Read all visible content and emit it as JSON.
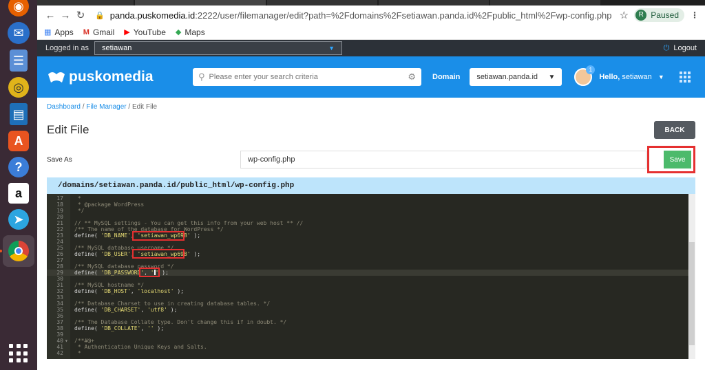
{
  "browser": {
    "url_host": "panda.puskomedia.id",
    "url_rest": ":2222/user/filemanager/edit?path=%2Fdomains%2Fsetiawan.panda.id%2Fpublic_html%2Fwp-config.php",
    "profile_initial": "R",
    "profile_status": "Paused",
    "bookmarks": [
      "Apps",
      "Gmail",
      "YouTube",
      "Maps"
    ]
  },
  "topbar": {
    "logged_in_label": "Logged in as",
    "user": "setiawan",
    "logout": "Logout"
  },
  "header": {
    "brand": "puskomedia",
    "search_placeholder": "Please enter your search criteria",
    "domain_label": "Domain",
    "domain_value": "setiawan.panda.id",
    "notification_count": "1",
    "hello": "Hello,",
    "hello_user": "setiawan"
  },
  "breadcrumb": {
    "dashboard": "Dashboard",
    "file_manager": "File Manager",
    "current": "Edit File",
    "sep": " / "
  },
  "page": {
    "title": "Edit File",
    "back": "BACK",
    "save_as_label": "Save As",
    "filename": "wp-config.php",
    "save": "Save",
    "path": "/domains/setiawan.panda.id/public_html/wp-config.php"
  },
  "editor": {
    "lines": [
      {
        "n": "17",
        "t": " *"
      },
      {
        "n": "18",
        "t": " * @package WordPress"
      },
      {
        "n": "19",
        "t": " */"
      },
      {
        "n": "20",
        "t": ""
      },
      {
        "n": "21",
        "t": "// ** MySQL settings - You can get this info from your web host ** //"
      },
      {
        "n": "22",
        "t": "/** The name of the database for WordPress */"
      },
      {
        "n": "23",
        "t": "define( 'DB_NAME', 'setiawan_wp698' );"
      },
      {
        "n": "24",
        "t": ""
      },
      {
        "n": "25",
        "t": "/** MySQL database username */"
      },
      {
        "n": "26",
        "t": "define( 'DB_USER', 'setiawan_wp698' );"
      },
      {
        "n": "27",
        "t": ""
      },
      {
        "n": "28",
        "t": "/** MySQL database password */"
      },
      {
        "n": "29",
        "t": "define( 'DB_PASSWORD', '' );"
      },
      {
        "n": "30",
        "t": ""
      },
      {
        "n": "31",
        "t": "/** MySQL hostname */"
      },
      {
        "n": "32",
        "t": "define( 'DB_HOST', 'localhost' );"
      },
      {
        "n": "33",
        "t": ""
      },
      {
        "n": "34",
        "t": "/** Database Charset to use in creating database tables. */"
      },
      {
        "n": "35",
        "t": "define( 'DB_CHARSET', 'utf8' );"
      },
      {
        "n": "36",
        "t": ""
      },
      {
        "n": "37",
        "t": "/** The Database Collate type. Don't change this if in doubt. */"
      },
      {
        "n": "38",
        "t": "define( 'DB_COLLATE', '' );"
      },
      {
        "n": "39",
        "t": ""
      },
      {
        "n": "40",
        "t": "/**#@+"
      },
      {
        "n": "41",
        "t": " * Authentication Unique Keys and Salts."
      },
      {
        "n": "42",
        "t": " *"
      }
    ]
  },
  "colors": {
    "brand_blue": "#1a8ee8",
    "save_green": "#4cba6b",
    "highlight_red": "#e53030",
    "editor_bg": "#272822"
  }
}
